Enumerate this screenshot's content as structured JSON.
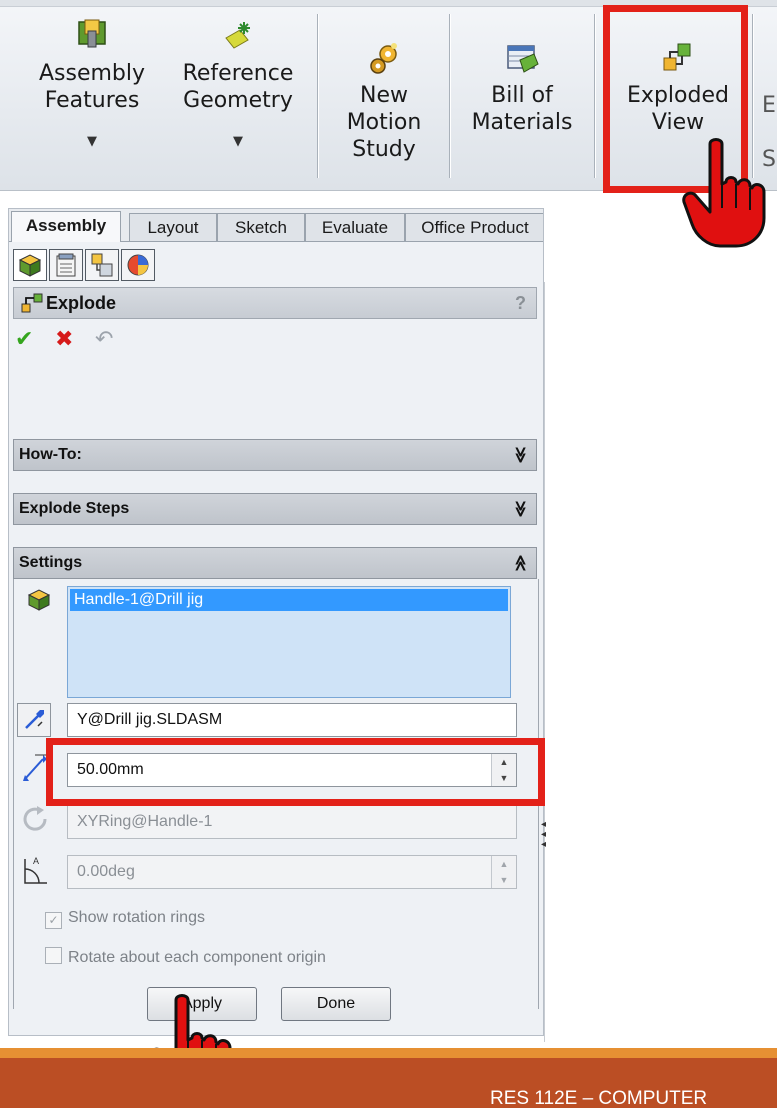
{
  "ribbon": {
    "assembly_features": {
      "line1": "Assembly",
      "line2": "Features",
      "icon": "assembly-features-icon"
    },
    "reference_geometry": {
      "line1": "Reference",
      "line2": "Geometry",
      "icon": "reference-geometry-icon"
    },
    "new_motion_study": {
      "line1": "New",
      "line2": "Motion",
      "line3": "Study",
      "icon": "motion-study-icon"
    },
    "bill_of_materials": {
      "line1": "Bill of",
      "line2": "Materials",
      "icon": "bill-of-materials-icon"
    },
    "exploded_view": {
      "line1": "Exploded",
      "line2": "View",
      "icon": "exploded-view-icon"
    },
    "cut_off": {
      "line1": "E",
      "line2": "",
      "line3": "S"
    },
    "dropdown_arrow": "▼"
  },
  "panel": {
    "tabs": [
      "Assembly",
      "Layout",
      "Sketch",
      "Evaluate",
      "Office Product"
    ],
    "title": "Explode",
    "help": "?",
    "ok_symbol": "✔",
    "cancel_symbol": "✖",
    "undo_symbol": "↶",
    "groups": {
      "how_to": "How-To:",
      "explode_steps": "Explode Steps",
      "settings": "Settings"
    },
    "chevron_down": "≫",
    "chevron_up": "≪",
    "settings": {
      "components": [
        "Handle-1@Drill jig"
      ],
      "direction": "Y@Drill jig.SLDASM",
      "distance": "50.00mm",
      "rotation_axis": "XYRing@Handle-1",
      "rotation_angle": "0.00deg",
      "show_rotation_rings": "Show rotation rings",
      "show_rotation_rings_checked": true,
      "rotate_about_origin": "Rotate about each component origin",
      "rotate_about_origin_checked": false
    },
    "apply_label": "Apply",
    "done_label": "Done"
  },
  "footer": {
    "text": "RES 112E – COMPUTER"
  },
  "colors": {
    "highlight": "#e32119",
    "footer_orange": "#e69033",
    "footer_rust": "#bb4e24"
  }
}
